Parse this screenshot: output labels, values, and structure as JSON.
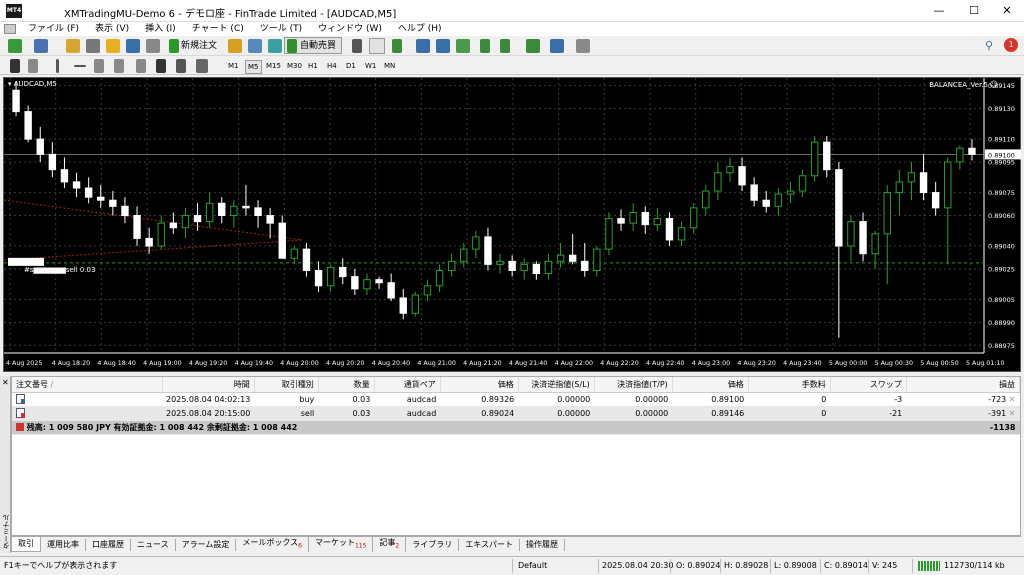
{
  "window": {
    "title": "XMTradingMU-Demo 6 - デモロ座 - FinTrade Limited - [AUDCAD,M5]",
    "minimize": "—",
    "maximize": "☐",
    "close": "✕"
  },
  "menu": [
    "ファイル (F)",
    "表示 (V)",
    "挿入 (I)",
    "チャート (C)",
    "ツール (T)",
    "ウィンドウ (W)",
    "ヘルプ (H)"
  ],
  "toolbar": {
    "new_order": "新規注文",
    "auto_trade": "自動売買",
    "timeframes": [
      "M1",
      "M5",
      "M15",
      "M30",
      "H1",
      "H4",
      "D1",
      "W1",
      "MN"
    ],
    "active_timeframe": "M5",
    "notification_count": "1"
  },
  "chart": {
    "symbol": "AUDCAD,M5",
    "ea": "BALANCEA_Ver.5",
    "sell_label": "#s▆▆▆▆▆▆sell 0.03",
    "current_price": "0.89100",
    "price_labels": [
      "0.89145",
      "0.89130",
      "0.89110",
      "0.89095",
      "0.89075",
      "0.89060",
      "0.89040",
      "0.89025",
      "0.89005",
      "0.88990",
      "0.88975"
    ],
    "time_labels": [
      "4 Aug 2025",
      "4 Aug 18:20",
      "4 Aug 18:40",
      "4 Aug 19:00",
      "4 Aug 19:20",
      "4 Aug 19:40",
      "4 Aug 20:00",
      "4 Aug 20:20",
      "4 Aug 20:40",
      "4 Aug 21:00",
      "4 Aug 21:20",
      "4 Aug 21:40",
      "4 Aug 22:00",
      "4 Aug 22:20",
      "4 Aug 22:40",
      "4 Aug 23:00",
      "4 Aug 23:20",
      "4 Aug 23:40",
      "5 Aug 00:00",
      "5 Aug 00:30",
      "5 Aug 00:50",
      "5 Aug 01:10"
    ]
  },
  "chart_data": {
    "type": "candlestick",
    "symbol": "AUDCAD",
    "timeframe": "M5",
    "ylim": [
      0.8897,
      0.8915
    ],
    "candles": [
      [
        0.89142,
        0.89148,
        0.89125,
        0.89128
      ],
      [
        0.89128,
        0.89132,
        0.89108,
        0.8911
      ],
      [
        0.8911,
        0.89118,
        0.89095,
        0.891
      ],
      [
        0.891,
        0.89108,
        0.89085,
        0.8909
      ],
      [
        0.8909,
        0.89098,
        0.89078,
        0.89082
      ],
      [
        0.89082,
        0.89088,
        0.89072,
        0.89078
      ],
      [
        0.89078,
        0.89085,
        0.89068,
        0.89072
      ],
      [
        0.89072,
        0.8908,
        0.89065,
        0.8907
      ],
      [
        0.8907,
        0.89076,
        0.8906,
        0.89066
      ],
      [
        0.89066,
        0.89072,
        0.89055,
        0.8906
      ],
      [
        0.8906,
        0.89066,
        0.8904,
        0.89045
      ],
      [
        0.89045,
        0.89052,
        0.89035,
        0.8904
      ],
      [
        0.8904,
        0.8906,
        0.89038,
        0.89055
      ],
      [
        0.89055,
        0.89062,
        0.89048,
        0.89052
      ],
      [
        0.89052,
        0.89065,
        0.89045,
        0.8906
      ],
      [
        0.8906,
        0.89068,
        0.8905,
        0.89056
      ],
      [
        0.89056,
        0.89075,
        0.89052,
        0.89068
      ],
      [
        0.89068,
        0.89072,
        0.89055,
        0.8906
      ],
      [
        0.8906,
        0.8907,
        0.89052,
        0.89066
      ],
      [
        0.89066,
        0.8908,
        0.8906,
        0.89065
      ],
      [
        0.89065,
        0.8907,
        0.89052,
        0.8906
      ],
      [
        0.8906,
        0.89065,
        0.89045,
        0.89055
      ],
      [
        0.89055,
        0.8906,
        0.8904,
        0.89032
      ],
      [
        0.89032,
        0.8904,
        0.89028,
        0.89038
      ],
      [
        0.89038,
        0.89042,
        0.8902,
        0.89024
      ],
      [
        0.89024,
        0.8903,
        0.8901,
        0.89014
      ],
      [
        0.89014,
        0.89028,
        0.8901,
        0.89026
      ],
      [
        0.89026,
        0.89032,
        0.89015,
        0.8902
      ],
      [
        0.8902,
        0.89025,
        0.89008,
        0.89012
      ],
      [
        0.89012,
        0.89022,
        0.89008,
        0.89018
      ],
      [
        0.89018,
        0.8902,
        0.89012,
        0.89016
      ],
      [
        0.89016,
        0.89022,
        0.89004,
        0.89006
      ],
      [
        0.89006,
        0.89012,
        0.88992,
        0.88996
      ],
      [
        0.88996,
        0.8901,
        0.88994,
        0.89008
      ],
      [
        0.89008,
        0.89018,
        0.89004,
        0.89014
      ],
      [
        0.89014,
        0.89028,
        0.8901,
        0.89024
      ],
      [
        0.89024,
        0.89035,
        0.8902,
        0.8903
      ],
      [
        0.8903,
        0.89042,
        0.89026,
        0.89038
      ],
      [
        0.89038,
        0.8905,
        0.89032,
        0.89046
      ],
      [
        0.89046,
        0.89052,
        0.89024,
        0.89028
      ],
      [
        0.89028,
        0.89035,
        0.89022,
        0.8903
      ],
      [
        0.8903,
        0.89034,
        0.8902,
        0.89024
      ],
      [
        0.89024,
        0.89032,
        0.89018,
        0.89028
      ],
      [
        0.89028,
        0.8903,
        0.89018,
        0.89022
      ],
      [
        0.89022,
        0.89035,
        0.89018,
        0.8903
      ],
      [
        0.8903,
        0.89042,
        0.89026,
        0.89034
      ],
      [
        0.89034,
        0.89048,
        0.89028,
        0.8903
      ],
      [
        0.8903,
        0.89042,
        0.8902,
        0.89024
      ],
      [
        0.89024,
        0.8904,
        0.8902,
        0.89038
      ],
      [
        0.89038,
        0.89062,
        0.89034,
        0.89058
      ],
      [
        0.89058,
        0.89064,
        0.8905,
        0.89055
      ],
      [
        0.89055,
        0.89068,
        0.8905,
        0.89062
      ],
      [
        0.89062,
        0.89066,
        0.89048,
        0.89054
      ],
      [
        0.89054,
        0.89065,
        0.8905,
        0.89058
      ],
      [
        0.89058,
        0.89062,
        0.8904,
        0.89044
      ],
      [
        0.89044,
        0.89056,
        0.8904,
        0.89052
      ],
      [
        0.89052,
        0.89068,
        0.89048,
        0.89065
      ],
      [
        0.89065,
        0.8908,
        0.8906,
        0.89076
      ],
      [
        0.89076,
        0.89095,
        0.8907,
        0.89088
      ],
      [
        0.89088,
        0.89098,
        0.89082,
        0.89092
      ],
      [
        0.89092,
        0.89098,
        0.89076,
        0.8908
      ],
      [
        0.8908,
        0.89085,
        0.89066,
        0.8907
      ],
      [
        0.8907,
        0.89076,
        0.89062,
        0.89066
      ],
      [
        0.89066,
        0.89078,
        0.8906,
        0.89074
      ],
      [
        0.89074,
        0.89082,
        0.89068,
        0.89076
      ],
      [
        0.89076,
        0.8909,
        0.89072,
        0.89086
      ],
      [
        0.89086,
        0.89112,
        0.89082,
        0.89108
      ],
      [
        0.89108,
        0.89112,
        0.89085,
        0.8909
      ],
      [
        0.8909,
        0.89095,
        0.8898,
        0.8904
      ],
      [
        0.8904,
        0.8906,
        0.8903,
        0.89056
      ],
      [
        0.89056,
        0.89062,
        0.8903,
        0.89035
      ],
      [
        0.89035,
        0.8905,
        0.89025,
        0.89048
      ],
      [
        0.89048,
        0.8908,
        0.89015,
        0.89075
      ],
      [
        0.89075,
        0.8909,
        0.8906,
        0.89082
      ],
      [
        0.89082,
        0.89095,
        0.8907,
        0.89088
      ],
      [
        0.89088,
        0.891,
        0.8907,
        0.89075
      ],
      [
        0.89075,
        0.89082,
        0.8906,
        0.89065
      ],
      [
        0.89065,
        0.89098,
        0.89028,
        0.89095
      ],
      [
        0.89095,
        0.89106,
        0.8909,
        0.89104
      ],
      [
        0.89104,
        0.8911,
        0.89096,
        0.891
      ]
    ],
    "indicator_line": {
      "level": 0.89029,
      "color": "#2aa02a"
    },
    "current_price": 0.891
  },
  "terminal": {
    "side_label": "ターミナル",
    "headers": [
      "注文番号",
      "時間",
      "取引種別",
      "数量",
      "通貨ペア",
      "価格",
      "決済逆指値(S/L)",
      "決済指値(T/P)",
      "価格",
      "手数料",
      "スワップ",
      "損益"
    ],
    "rows": [
      {
        "ticket": "",
        "time": "2025.08.04 04:02:13",
        "type": "buy",
        "size": "0.03",
        "symbol": "audcad",
        "price": "0.89326",
        "sl": "0.00000",
        "tp": "0.00000",
        "cur": "0.89100",
        "commission": "0",
        "swap": "-3",
        "profit": "-723"
      },
      {
        "ticket": "",
        "time": "2025.08.04 20:15:00",
        "type": "sell",
        "size": "0.03",
        "symbol": "audcad",
        "price": "0.89024",
        "sl": "0.00000",
        "tp": "0.00000",
        "cur": "0.89146",
        "commission": "0",
        "swap": "-21",
        "profit": "-391"
      }
    ],
    "summary": "残高: 1 009 580 JPY  有効証拠金: 1 008 442  余剰証拠金: 1 008 442",
    "summary_profit": "-1138",
    "tabs": [
      "取引",
      "運用比率",
      "口座履歴",
      "ニュース",
      "アラーム設定",
      "メールボックス",
      "マーケット",
      "記事",
      "ライブラリ",
      "エキスパート",
      "操作履歴"
    ],
    "tab_badges": {
      "mailbox": "6",
      "market": "115",
      "articles": "2"
    }
  },
  "status": {
    "help": "F1キーでヘルプが表示されます",
    "profile": "Default",
    "datetime": "2025.08.04 20:30",
    "open": "O: 0.89024",
    "high": "H: 0.89028",
    "low": "L: 0.89008",
    "close": "C: 0.89014",
    "volume": "V: 245",
    "traffic": "112730/114 kb"
  }
}
